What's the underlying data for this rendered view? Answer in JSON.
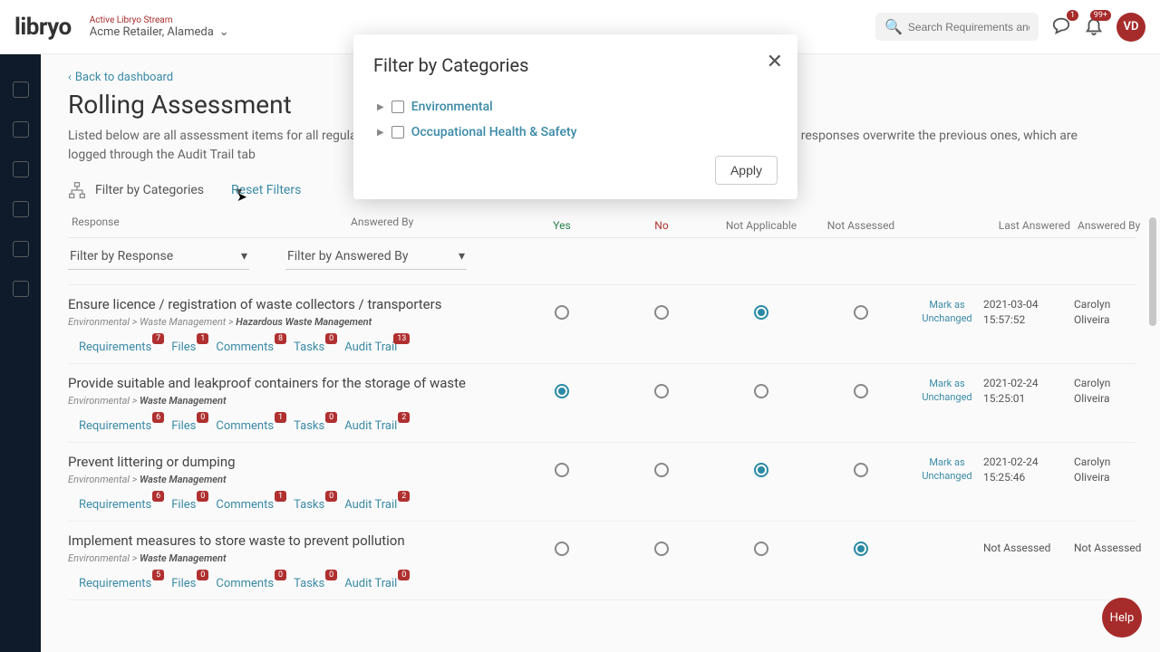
{
  "top": {
    "logo": "libryo",
    "stream_label": "Active Libryo Stream",
    "stream_name": "Acme Retailer, Alameda",
    "search_placeholder": "Search Requirements and Dr.",
    "chat_badge": "1",
    "bell_badge": "99+",
    "avatar": "VD"
  },
  "page": {
    "back": "Back to dashboard",
    "title": "Rolling Assessment",
    "desc": "Listed below are all assessment items for all regulations for all the items you have access to as an assess module user. The latest responses overwrite the previous ones, which are logged through the Audit Trail tab",
    "filter_cat": "Filter by Categories",
    "reset": "Reset Filters"
  },
  "cols": {
    "response": "Response",
    "answered_by": "Answered By",
    "yes": "Yes",
    "no": "No",
    "na": "Not Applicable",
    "nas": "Not Assessed",
    "last": "Last Answered",
    "by": "Answered By",
    "filter_response": "Filter by Response",
    "filter_answered": "Filter by Answered By"
  },
  "mark": "Mark as Unchanged",
  "not_assessed_text": "Not Assessed",
  "tabs": [
    "Requirements",
    "Files",
    "Comments",
    "Tasks",
    "Audit Trail"
  ],
  "items": [
    {
      "title": "Ensure licence / registration of waste collectors / transporters",
      "crumb": "Environmental > Waste Management > ",
      "crumb_bold": "Hazardous Waste Management",
      "selected": 2,
      "ts": "2021-03-04 15:57:52",
      "by": "Carolyn Oliveira",
      "counts": [
        7,
        1,
        8,
        0,
        13
      ],
      "mark": true
    },
    {
      "title": "Provide suitable and leakproof containers for the storage of waste",
      "crumb": "Environmental > ",
      "crumb_bold": "Waste Management",
      "selected": 0,
      "ts": "2021-02-24 15:25:01",
      "by": "Carolyn Oliveira",
      "counts": [
        6,
        0,
        1,
        0,
        2
      ],
      "mark": true
    },
    {
      "title": "Prevent littering or dumping",
      "crumb": "Environmental > ",
      "crumb_bold": "Waste Management",
      "selected": 2,
      "ts": "2021-02-24 15:25:46",
      "by": "Carolyn Oliveira",
      "counts": [
        6,
        0,
        1,
        0,
        2
      ],
      "mark": true
    },
    {
      "title": "Implement measures to store waste to prevent pollution",
      "crumb": "Environmental > ",
      "crumb_bold": "Waste Management",
      "selected": 3,
      "ts": "Not Assessed",
      "by": "Not Assessed",
      "counts": [
        5,
        0,
        0,
        0,
        0
      ],
      "mark": false
    }
  ],
  "modal": {
    "title": "Filter by Categories",
    "opt1": "Environmental",
    "opt2": "Occupational Health & Safety",
    "apply": "Apply"
  },
  "help": "Help"
}
